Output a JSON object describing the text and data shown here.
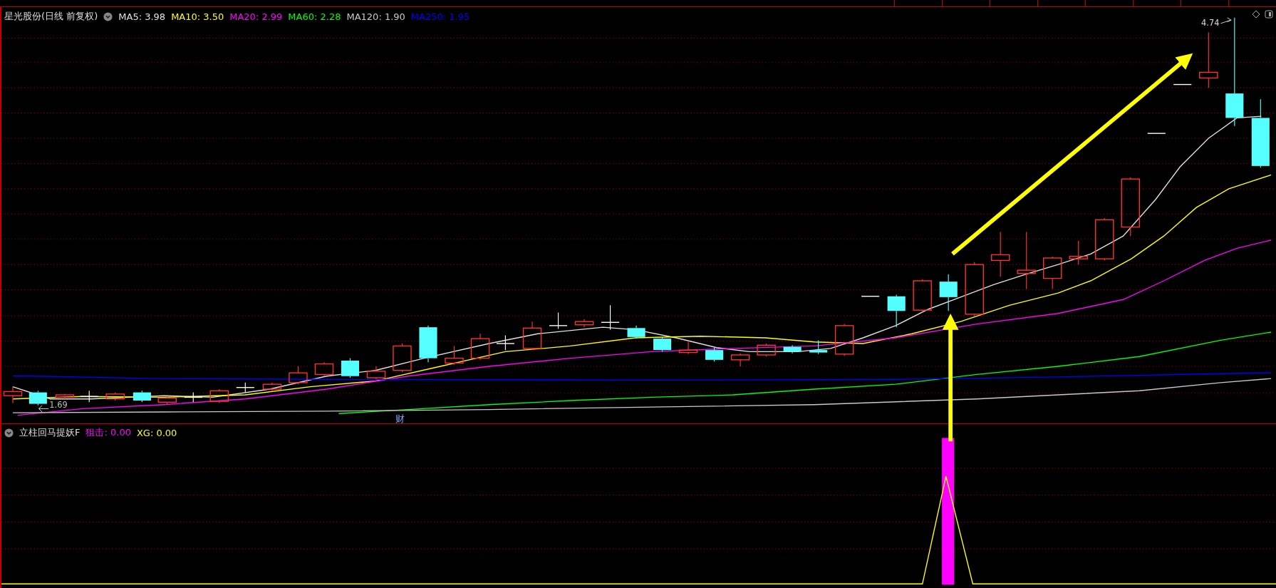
{
  "chart": {
    "title": "星光股份(日线 前复权)",
    "moving_averages": [
      {
        "label": "MA5: 3.98",
        "color": "#e0e0e0"
      },
      {
        "label": "MA10: 3.50",
        "color": "#ffff00"
      },
      {
        "label": "MA20: 2.99",
        "color": "#ff00ff"
      },
      {
        "label": "MA60: 2.28",
        "color": "#00ff00"
      },
      {
        "label": "MA120: 1.90",
        "color": "#c8c8c8"
      },
      {
        "label": "MA250: 1.95",
        "color": "#0000ff"
      }
    ],
    "high_label": "4.74",
    "low_label": "1.69",
    "event_marker": "财"
  },
  "indicator": {
    "title": "立柱回马提妖F",
    "values": [
      {
        "label": "狙击: 0.00",
        "color": "#ff00ff"
      },
      {
        "label": "XG: 0.00",
        "color": "#ffff00"
      }
    ]
  }
}
